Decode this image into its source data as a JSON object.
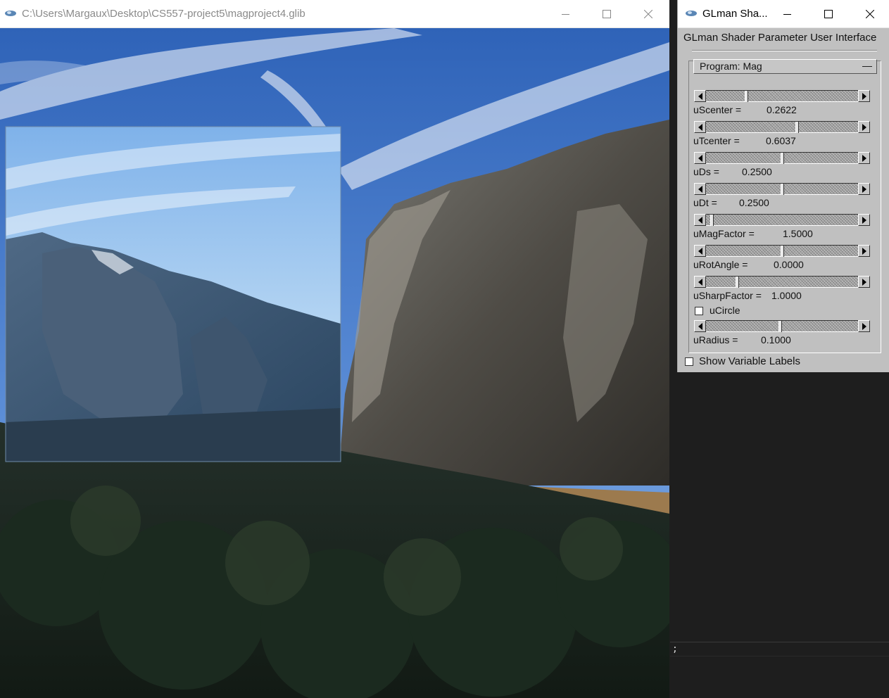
{
  "render_window": {
    "title": "C:\\Users\\Margaux\\Desktop\\CS557-project5\\magproject4.glib",
    "icons": {
      "app": "glman-icon",
      "minimize": "minimize-icon",
      "maximize": "maximize-icon",
      "close": "close-icon"
    },
    "canvas": {
      "scene": "Yosemite valley photo with magnified inset lens",
      "lens": "magnified-region"
    }
  },
  "panel": {
    "title": "GLman Sha...",
    "heading": "GLman Shader Parameter User Interface",
    "program_label": "Program: Mag",
    "collapse_label": "—",
    "params": [
      {
        "name": "uScenter =",
        "value": "0.2622",
        "fraction": 0.2622
      },
      {
        "name": "uTcenter =",
        "value": "0.6037",
        "fraction": 0.6037
      },
      {
        "name": "uDs =",
        "value": "0.2500",
        "fraction": 0.5
      },
      {
        "name": "uDt =",
        "value": "0.2500",
        "fraction": 0.5
      },
      {
        "name": "uMagFactor =",
        "value": "1.5000",
        "fraction": 0.03
      },
      {
        "name": "uRotAngle =",
        "value": "0.0000",
        "fraction": 0.5
      },
      {
        "name": "uSharpFactor =",
        "value": "1.0000",
        "fraction": 0.2
      }
    ],
    "ucircle_label": "uCircle",
    "ucircle_checked": false,
    "radius": {
      "name": "uRadius =",
      "value": "0.1000",
      "fraction": 0.49
    },
    "show_labels": "Show Variable Labels",
    "show_labels_checked": false
  },
  "console": {
    "text": ";"
  }
}
